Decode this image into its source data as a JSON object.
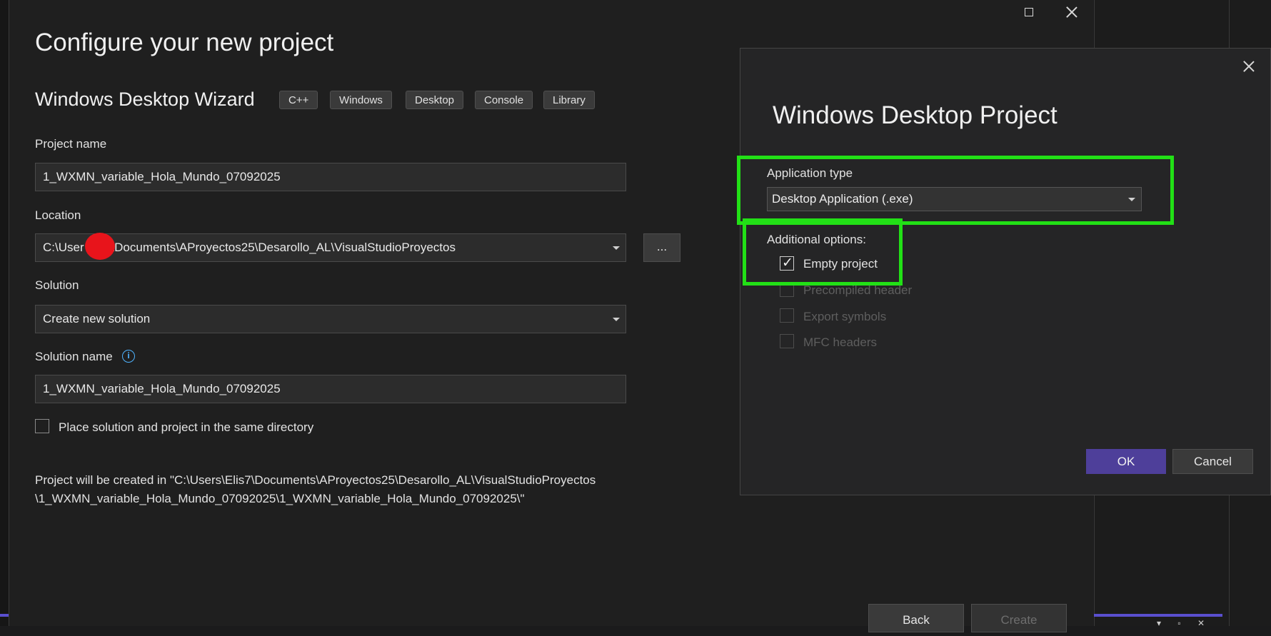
{
  "page": {
    "title": "Configure your new project",
    "wizard_name": "Windows Desktop Wizard",
    "tags": [
      "C++",
      "Windows",
      "Desktop",
      "Console",
      "Library"
    ]
  },
  "form": {
    "project_name_label": "Project name",
    "project_name_value": "1_WXMN_variable_Hola_Mundo_07092025",
    "location_label": "Location",
    "location_value": "C:\\User      7\\Documents\\AProyectos25\\Desarollo_AL\\VisualStudioProyectos",
    "browse_label": "...",
    "solution_label": "Solution",
    "solution_value": "Create new solution",
    "solution_name_label": "Solution name",
    "info_icon_glyph": "i",
    "solution_name_value": "1_WXMN_variable_Hola_Mundo_07092025",
    "same_dir_label": "Place solution and project in the same directory",
    "path_line1": "Project will be created in \"C:\\Users\\Elis7\\Documents\\AProyectos25\\Desarollo_AL\\VisualStudioProyectos",
    "path_line2": "\\1_WXMN_variable_Hola_Mundo_07092025\\1_WXMN_variable_Hola_Mundo_07092025\\\""
  },
  "footer": {
    "back_label": "Back",
    "create_label": "Create"
  },
  "dialog": {
    "title": "Windows Desktop Project",
    "app_type_label": "Application type",
    "app_type_value": "Desktop Application (.exe)",
    "additional_label": "Additional options:",
    "options": [
      {
        "label": "Empty project",
        "checked": true,
        "enabled": true
      },
      {
        "label": "Precompiled header",
        "checked": false,
        "enabled": false
      },
      {
        "label": "Export symbols",
        "checked": false,
        "enabled": false
      },
      {
        "label": "MFC headers",
        "checked": false,
        "enabled": false
      }
    ],
    "ok_label": "OK",
    "cancel_label": "Cancel"
  },
  "colors": {
    "highlight": "#22e016",
    "ok_button": "#4e3f9a",
    "redaction": "#e8141b",
    "info_icon": "#4fb3ff"
  },
  "icons": {
    "maximize": "maximize-icon",
    "close": "close-icon",
    "dialog_close": "close-icon",
    "info": "info-icon",
    "dropdown": "chevron-down-icon"
  }
}
